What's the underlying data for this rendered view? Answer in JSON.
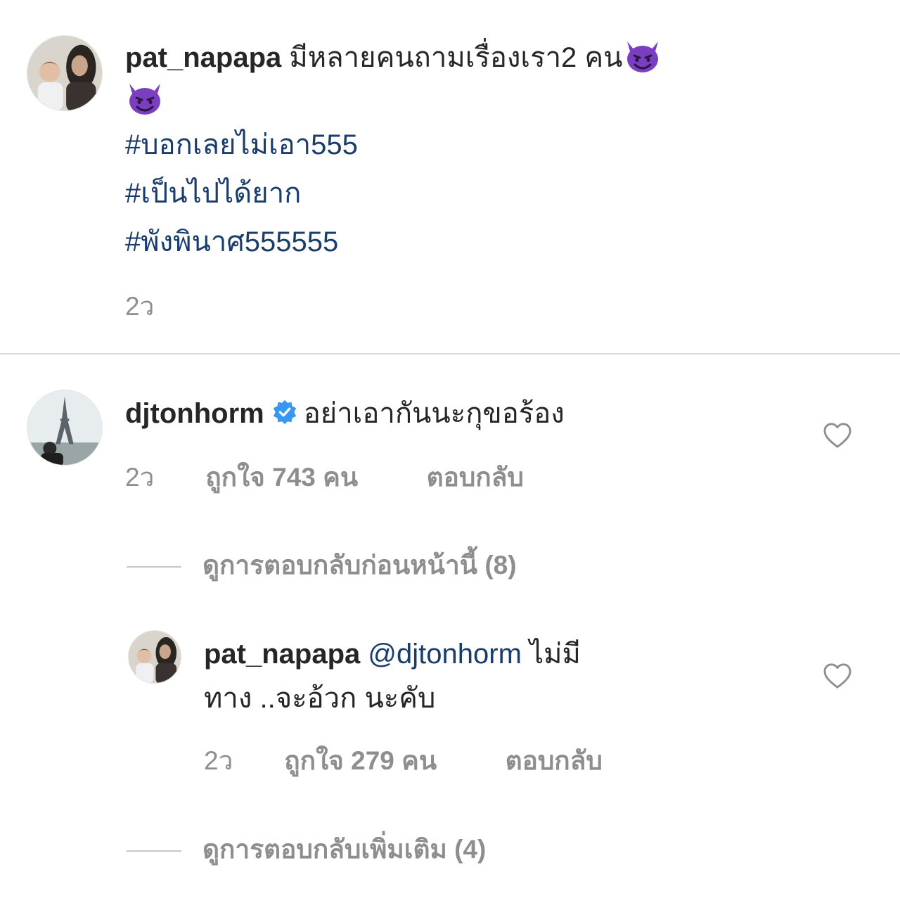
{
  "post_caption": {
    "username": "pat_napapa",
    "text": "มีหลายคนถามเรื่องเรา2 คน",
    "emoji_icon": "smiling-devil-emoji",
    "hashtags": [
      "#บอกเลยไม่เอา555",
      "#เป็นไปได้ยาก",
      "#พังพินาศ555555"
    ],
    "time": "2ว"
  },
  "comment": {
    "username": "djtonhorm",
    "verified_icon": "verified-badge-icon",
    "text": "อย่าเอากันนะกุขอร้อง",
    "time": "2ว",
    "likes": "ถูกใจ 743 คน",
    "reply_label": "ตอบกลับ",
    "view_previous_replies": "ดูการตอบกลับก่อนหน้านี้ (8)"
  },
  "reply": {
    "username": "pat_napapa",
    "mention": "@djtonhorm",
    "text_line1": "ไม่มี",
    "text_line2": "ทาง ..จะอ้วก นะคับ",
    "time": "2ว",
    "likes": "ถูกใจ 279 คน",
    "reply_label": "ตอบกลับ",
    "view_more_replies": "ดูการตอบกลับเพิ่มเติม (4)"
  },
  "colors": {
    "text": "#262626",
    "secondary": "#8e8e8e",
    "link": "#1b3d6e",
    "verified": "#3897f0",
    "emoji_purple": "#7a3fc0",
    "divider": "#dbdbdb"
  }
}
